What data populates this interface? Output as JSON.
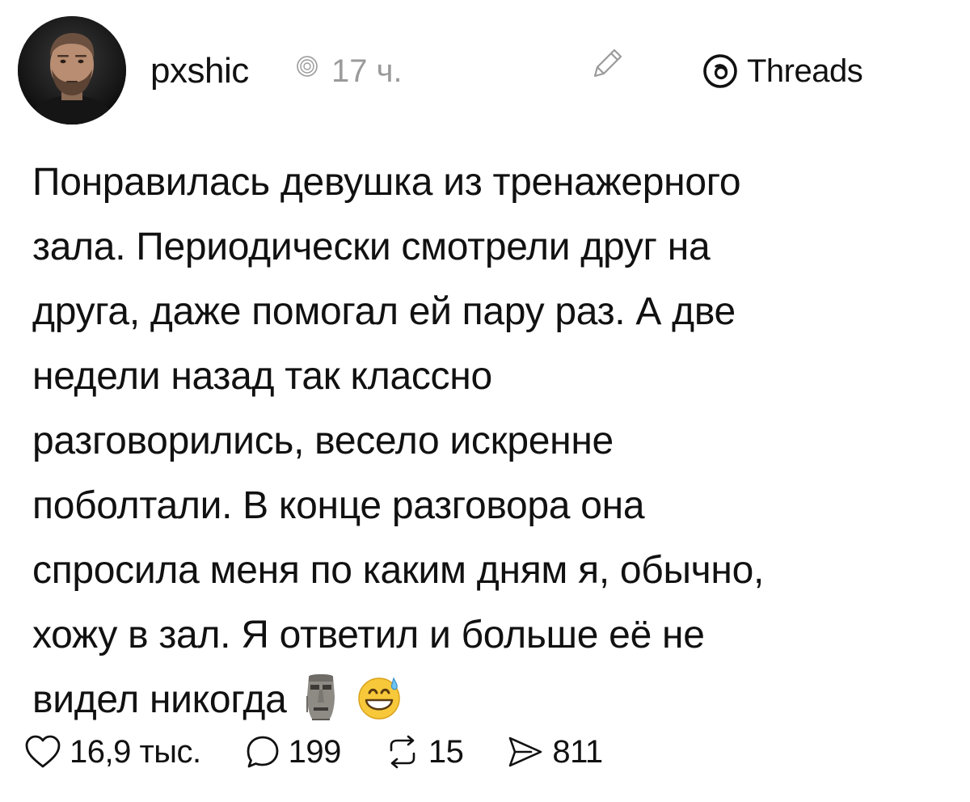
{
  "header": {
    "username": "pxshic",
    "timestamp": "17 ч.",
    "badge_label": "Threads"
  },
  "post": {
    "lines": [
      "Понравилась девушка из тренажерного",
      "зала. Периодически смотрели друг на",
      "друга, даже помогал ей пару раз. А две",
      "недели назад так классно",
      "разговорились, весело искренне",
      "поболтали. В конце разговора она",
      "спросила меня по каким дням я, обычно,",
      "хожу в зал. Я ответил и больше её не",
      "видел никогда"
    ],
    "emojis": [
      "moai-icon",
      "grinning-sweat-icon"
    ]
  },
  "actions": {
    "likes": "16,9 тыс.",
    "comments": "199",
    "reposts": "15",
    "shares": "811"
  },
  "icons": {
    "avatar": "avatar-photo",
    "verified": "verified-badge-icon",
    "edit": "pencil-icon",
    "threads": "threads-logo-icon",
    "like": "heart-icon",
    "comment": "comment-bubble-icon",
    "repost": "repost-icon",
    "share": "send-icon"
  },
  "colors": {
    "text": "#111111",
    "muted": "#9a9a9a",
    "background": "#ffffff"
  }
}
